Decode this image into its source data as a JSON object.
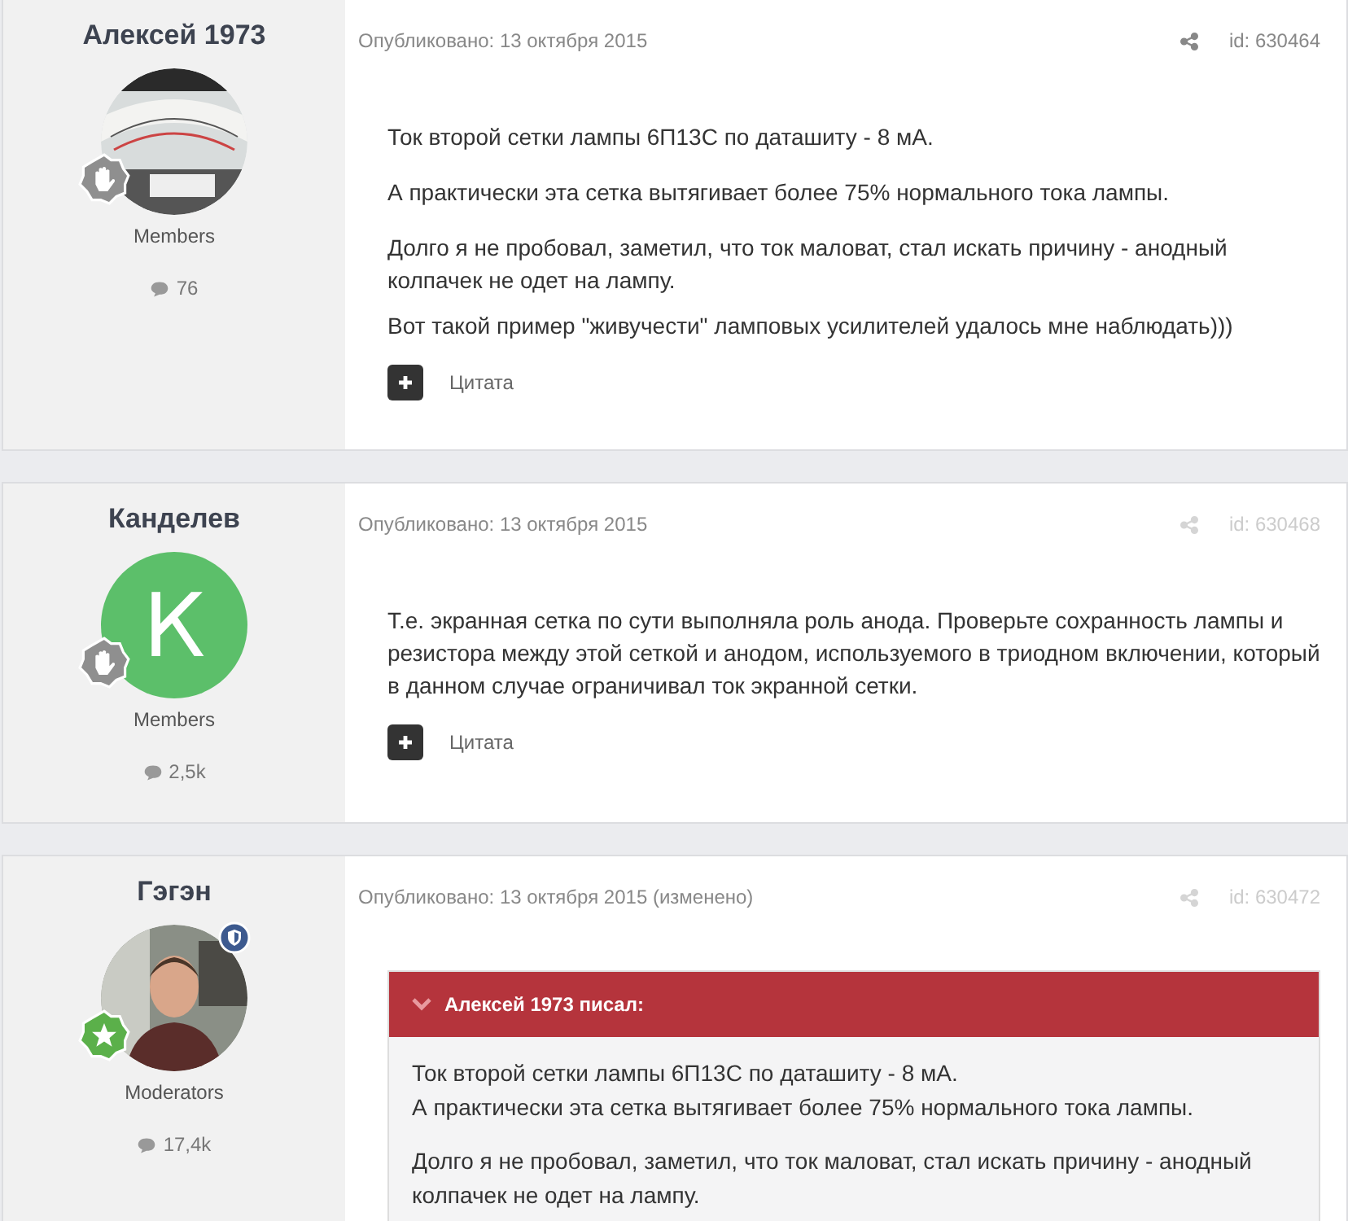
{
  "posts": [
    {
      "author": "Алексей 1973",
      "rank_badge": {
        "kind": "hand"
      },
      "moderator_badge": false,
      "group": "Members",
      "post_count": "76",
      "published": "Опубликовано: 13 октября 2015",
      "post_id": "id: 630464",
      "meta_highlighted": true,
      "paragraphs": [
        "Ток второй сетки лампы 6П13С по даташиту - 8 мА.",
        "А практически эта сетка вытягивает более 75% нормального тока лампы.",
        "Долго я не пробовал, заметил, что ток маловат, стал искать причину - анодный колпачек не одет на лампу.",
        "Вот такой пример \"живучести\" ламповых усилителей удалось мне наблюдать)))"
      ],
      "quote_button": "Цитата"
    },
    {
      "author": "Канделев",
      "avatar": {
        "kind": "letter",
        "letter": "К",
        "color": "#5cbf6a"
      },
      "rank_badge": {
        "kind": "hand"
      },
      "moderator_badge": false,
      "group": "Members",
      "post_count": "2,5k",
      "published": "Опубликовано: 13 октября 2015",
      "post_id": "id: 630468",
      "meta_highlighted": false,
      "paragraphs": [
        "Т.е. экранная сетка по сути выполняла роль анода. Проверьте сохранность лампы и резистора между этой сеткой и анодом, используемого в триодном включении, который в данном случае ограничивал ток экранной сетки."
      ],
      "quote_button": "Цитата"
    },
    {
      "author": "Гэгэн",
      "rank_badge": {
        "kind": "star"
      },
      "moderator_badge": true,
      "group": "Moderators",
      "post_count": "17,4k",
      "published": "Опубликовано: 13 октября 2015 (изменено)",
      "post_id": "id: 630472",
      "meta_highlighted": false,
      "quote": {
        "header": "Алексей 1973 писал:",
        "paragraphs": [
          [
            "Ток второй сетки лампы 6П13С по даташиту - 8 мА.",
            "А практически эта сетка вытягивает более 75% нормального тока лампы."
          ],
          [
            "Долго я не пробовал, заметил, что ток маловат, стал искать причину - анодный колпачек не одет на лампу."
          ]
        ]
      }
    }
  ]
}
